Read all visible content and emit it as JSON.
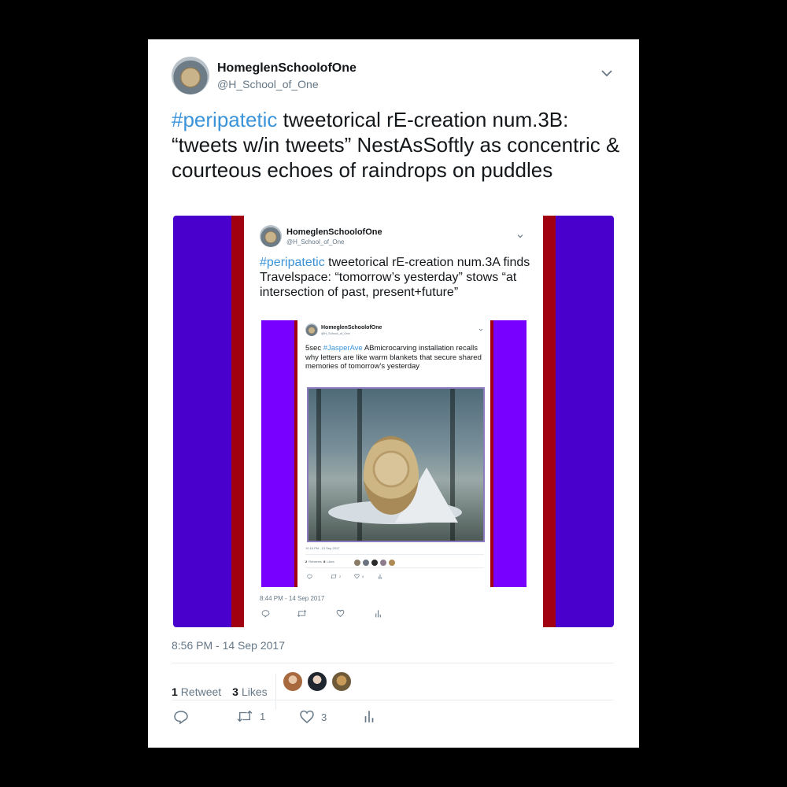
{
  "tweet": {
    "display_name": "HomeglenSchoolofOne",
    "handle": "@H_School_of_One",
    "hashtag": "#peripatetic",
    "text": " tweetorical rE-creation num.3B: “tweets w/in tweets” NestAsSoftly as concentric & courteous echoes of raindrops on puddles",
    "timestamp": "8:56 PM - 14 Sep 2017",
    "retweets_count": "1",
    "retweets_label": "Retweet",
    "likes_count": "3",
    "likes_label": "Likes",
    "retweet_action_count": "1",
    "like_action_count": "3",
    "colors": {
      "link": "#3b94d9",
      "media_bg": "#4a00cc",
      "stripe": "#a00010"
    },
    "icons": [
      "caret-down-icon",
      "reply-icon",
      "retweet-icon",
      "heart-icon",
      "analytics-icon"
    ],
    "quoted": {
      "display_name": "HomeglenSchoolofOne",
      "handle": "@H_School_of_One",
      "hashtag": "#peripatetic",
      "text": " tweetorical rE-creation num.3A finds Travelspace: “tomorrow’s yesterday” stows “at intersection of past, present+future”",
      "timestamp": "8:44 PM - 14 Sep 2017",
      "colors": {
        "media_bg": "#7700ff"
      },
      "quoted": {
        "display_name": "HomeglenSchoolofOne",
        "handle": "@H_School_of_One",
        "prefix": "5sec ",
        "hashtag": "#JasperAve",
        "text": " ABmicrocarving installation recalls why letters are like warm blankets that secure shared memories of tomorrow’s yesterday",
        "timestamp": "10:18 PM - 13 Sep 2017",
        "retweets_count": "2",
        "retweets_label": "Retweets",
        "likes_count": "8",
        "likes_label": "Likes",
        "retweet_action_count": "2",
        "like_action_count": "5"
      }
    }
  }
}
